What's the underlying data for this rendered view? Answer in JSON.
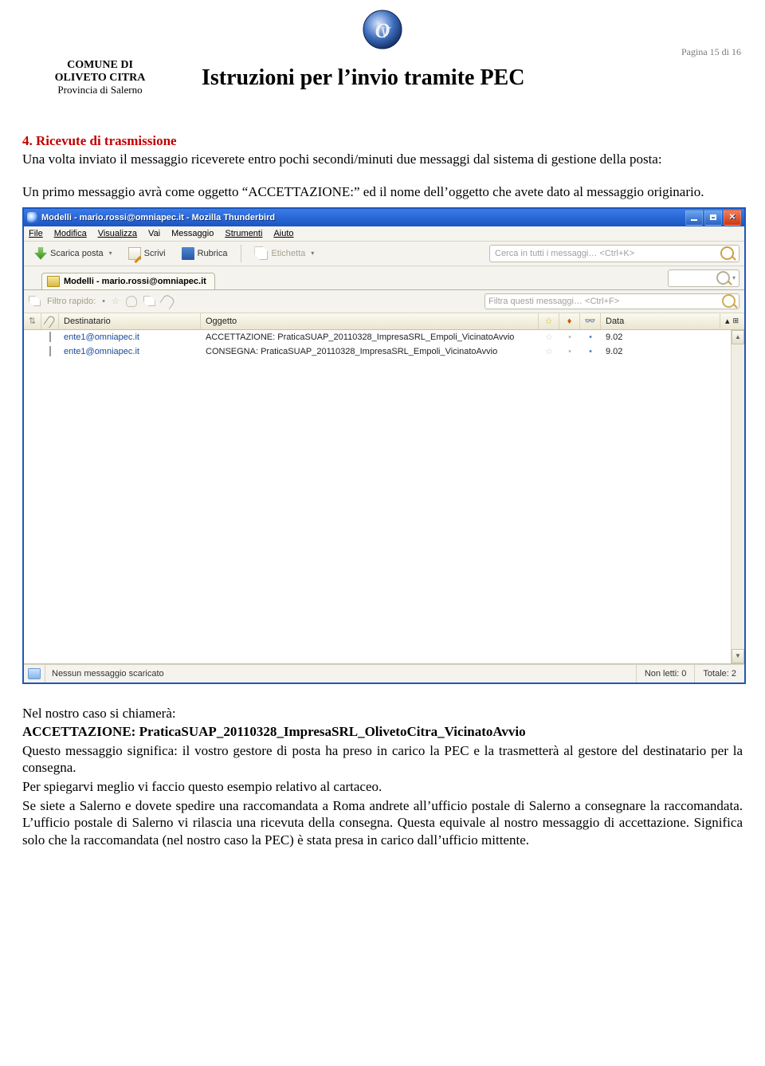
{
  "page_number_label": "Pagina 15 di 16",
  "comune": {
    "line1": "COMUNE DI",
    "line2": "OLIVETO CITRA",
    "line3": "Provincia di  Salerno"
  },
  "doc_title": "Istruzioni per l’invio tramite PEC",
  "section_title": "4. Ricevute di trasmissione",
  "intro_p1": "Una volta inviato il messaggio riceverete entro pochi secondi/minuti due messaggi dal sistema di gestione della posta:",
  "intro_p2": "Un primo messaggio avrà come oggetto “ACCETTAZIONE:” ed il nome dell’oggetto che avete dato al messaggio originario.",
  "thunderbird": {
    "title": "Modelli - mario.rossi@omniapec.it - Mozilla Thunderbird",
    "menu": [
      "File",
      "Modifica",
      "Visualizza",
      "Vai",
      "Messaggio",
      "Strumenti",
      "Aiuto"
    ],
    "toolbar": {
      "scarica": "Scarica posta",
      "scrivi": "Scrivi",
      "rubrica": "Rubrica",
      "etichetta": "Etichetta",
      "search_placeholder": "Cerca in tutti i messaggi… <Ctrl+K>"
    },
    "tab_label": "Modelli - mario.rossi@omniapec.it",
    "filter": {
      "label": "Filtro rapido:",
      "search_placeholder": "Filtra questi messaggi… <Ctrl+F>"
    },
    "columns": {
      "dest": "Destinatario",
      "subj": "Oggetto",
      "date": "Data"
    },
    "rows": [
      {
        "dest": "ente1@omniapec.it",
        "subj": "ACCETTAZIONE: PraticaSUAP_20110328_ImpresaSRL_Empoli_VicinatoAvvio",
        "date": "9.02"
      },
      {
        "dest": "ente1@omniapec.it",
        "subj": "CONSEGNA: PraticaSUAP_20110328_ImpresaSRL_Empoli_VicinatoAvvio",
        "date": "9.02"
      }
    ],
    "status": {
      "left": "Nessun messaggio scaricato",
      "non_letti": "Non letti: 0",
      "totale": "Totale: 2"
    }
  },
  "after": {
    "p1": "Nel nostro caso si chiamerà:",
    "p2": "ACCETTAZIONE: PraticaSUAP_20110328_ImpresaSRL_OlivetoCitra_VicinatoAvvio",
    "p3": "Questo messaggio significa: il vostro gestore di posta ha preso in carico la PEC e la trasmetterà al gestore del destinatario per la consegna.",
    "p4": "Per spiegarvi meglio vi faccio questo esempio relativo al cartaceo.",
    "p5": "Se siete a Salerno e dovete spedire una raccomandata a Roma andrete all’ufficio postale di Salerno a consegnare la raccomandata. L’ufficio postale di Salerno vi rilascia una ricevuta della consegna. Questa equivale al nostro messaggio di accettazione. Significa solo che la raccomandata (nel nostro caso la PEC) è stata presa in carico dall’ufficio mittente."
  }
}
